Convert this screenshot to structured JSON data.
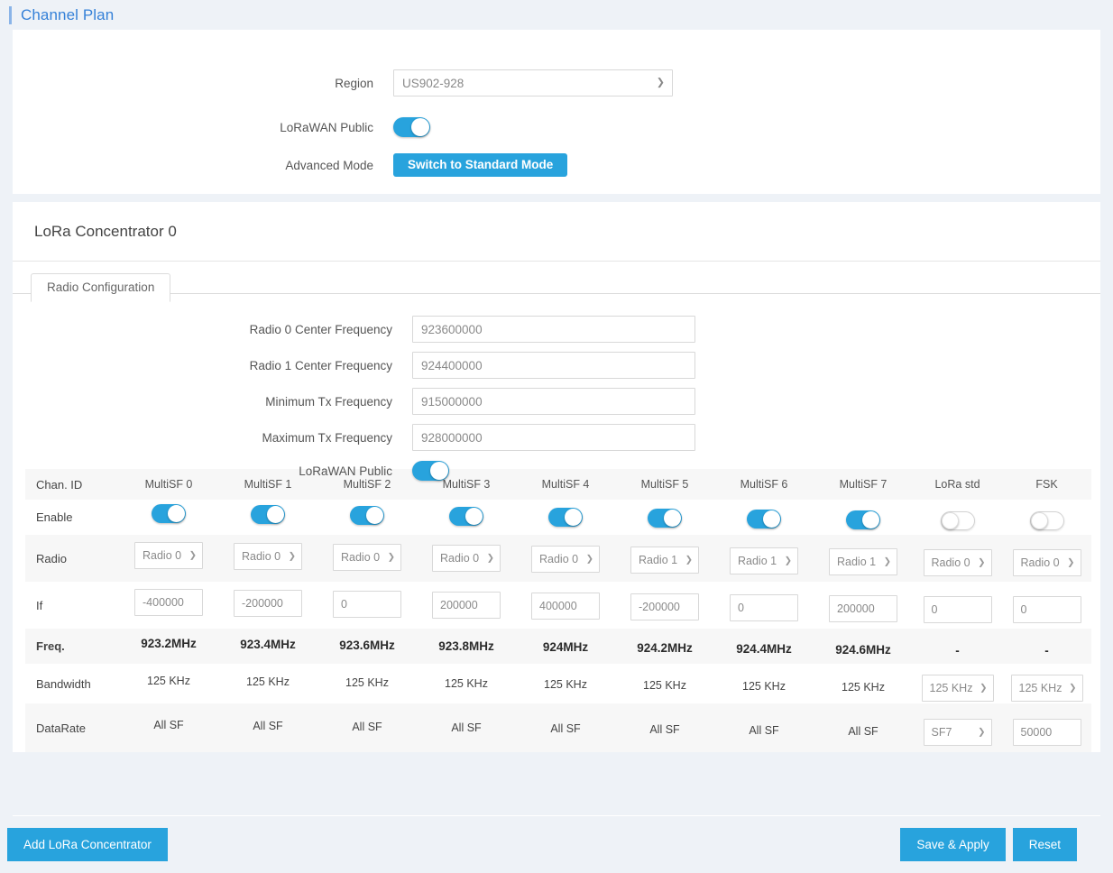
{
  "page": {
    "title": "Channel Plan"
  },
  "colors": {
    "accent": "#28a3dd",
    "title": "#3581d8",
    "page_bg": "#eef2f7"
  },
  "settings": {
    "region_label": "Region",
    "region_value": "US902-928",
    "lorawan_public_label": "LoRaWAN Public",
    "lorawan_public_on": true,
    "advanced_mode_label": "Advanced Mode",
    "switch_button": "Switch to Standard Mode"
  },
  "concentrator": {
    "title": "LoRa Concentrator 0",
    "tab": "Radio Configuration",
    "fields": [
      {
        "label": "Radio 0 Center Frequency",
        "value": "923600000"
      },
      {
        "label": "Radio 1 Center Frequency",
        "value": "924400000"
      },
      {
        "label": "Minimum Tx Frequency",
        "value": "915000000"
      },
      {
        "label": "Maximum Tx Frequency",
        "value": "928000000"
      }
    ],
    "lorawan_public_label": "LoRaWAN Public",
    "lorawan_public_on": true
  },
  "table": {
    "row_labels": {
      "chan_id": "Chan. ID",
      "enable": "Enable",
      "radio": "Radio",
      "if": "If",
      "freq": "Freq.",
      "bandwidth": "Bandwidth",
      "datarate": "DataRate"
    },
    "columns": [
      "MultiSF 0",
      "MultiSF 1",
      "MultiSF 2",
      "MultiSF 3",
      "MultiSF 4",
      "MultiSF 5",
      "MultiSF 6",
      "MultiSF 7",
      "LoRa std",
      "FSK"
    ],
    "enable": [
      true,
      true,
      true,
      true,
      true,
      true,
      true,
      true,
      false,
      false
    ],
    "radio": [
      "Radio 0",
      "Radio 0",
      "Radio 0",
      "Radio 0",
      "Radio 0",
      "Radio 1",
      "Radio 1",
      "Radio 1",
      "Radio 0",
      "Radio 0"
    ],
    "if": [
      "-400000",
      "-200000",
      "0",
      "200000",
      "400000",
      "-200000",
      "0",
      "200000",
      "0",
      "0"
    ],
    "freq": [
      "923.2MHz",
      "923.4MHz",
      "923.6MHz",
      "923.8MHz",
      "924MHz",
      "924.2MHz",
      "924.4MHz",
      "924.6MHz",
      "-",
      "-"
    ],
    "bandwidth": [
      "125 KHz",
      "125 KHz",
      "125 KHz",
      "125 KHz",
      "125 KHz",
      "125 KHz",
      "125 KHz",
      "125 KHz",
      "125 KHz",
      "125 KHz"
    ],
    "datarate": [
      "All SF",
      "All SF",
      "All SF",
      "All SF",
      "All SF",
      "All SF",
      "All SF",
      "All SF",
      "SF7",
      "50000"
    ]
  },
  "footer": {
    "add_concentrator": "Add LoRa Concentrator",
    "save_apply": "Save & Apply",
    "reset": "Reset"
  },
  "icons": {
    "chevron_down": "∨"
  }
}
